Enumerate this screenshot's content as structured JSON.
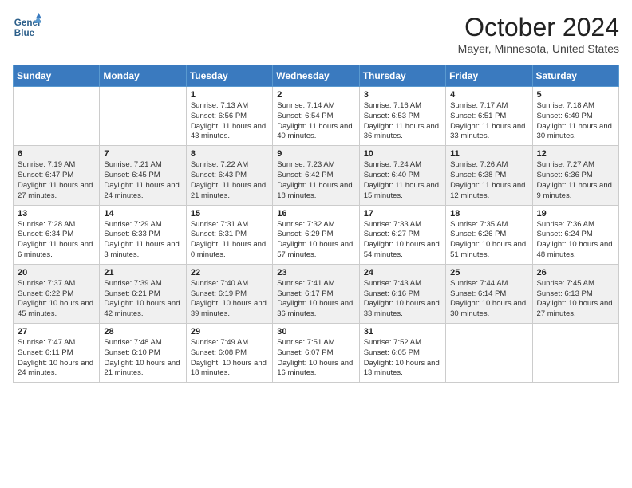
{
  "header": {
    "logo_line1": "General",
    "logo_line2": "Blue",
    "month": "October 2024",
    "location": "Mayer, Minnesota, United States"
  },
  "weekdays": [
    "Sunday",
    "Monday",
    "Tuesday",
    "Wednesday",
    "Thursday",
    "Friday",
    "Saturday"
  ],
  "rows": [
    [
      {
        "day": "",
        "info": ""
      },
      {
        "day": "",
        "info": ""
      },
      {
        "day": "1",
        "info": "Sunrise: 7:13 AM\nSunset: 6:56 PM\nDaylight: 11 hours and 43 minutes."
      },
      {
        "day": "2",
        "info": "Sunrise: 7:14 AM\nSunset: 6:54 PM\nDaylight: 11 hours and 40 minutes."
      },
      {
        "day": "3",
        "info": "Sunrise: 7:16 AM\nSunset: 6:53 PM\nDaylight: 11 hours and 36 minutes."
      },
      {
        "day": "4",
        "info": "Sunrise: 7:17 AM\nSunset: 6:51 PM\nDaylight: 11 hours and 33 minutes."
      },
      {
        "day": "5",
        "info": "Sunrise: 7:18 AM\nSunset: 6:49 PM\nDaylight: 11 hours and 30 minutes."
      }
    ],
    [
      {
        "day": "6",
        "info": "Sunrise: 7:19 AM\nSunset: 6:47 PM\nDaylight: 11 hours and 27 minutes."
      },
      {
        "day": "7",
        "info": "Sunrise: 7:21 AM\nSunset: 6:45 PM\nDaylight: 11 hours and 24 minutes."
      },
      {
        "day": "8",
        "info": "Sunrise: 7:22 AM\nSunset: 6:43 PM\nDaylight: 11 hours and 21 minutes."
      },
      {
        "day": "9",
        "info": "Sunrise: 7:23 AM\nSunset: 6:42 PM\nDaylight: 11 hours and 18 minutes."
      },
      {
        "day": "10",
        "info": "Sunrise: 7:24 AM\nSunset: 6:40 PM\nDaylight: 11 hours and 15 minutes."
      },
      {
        "day": "11",
        "info": "Sunrise: 7:26 AM\nSunset: 6:38 PM\nDaylight: 11 hours and 12 minutes."
      },
      {
        "day": "12",
        "info": "Sunrise: 7:27 AM\nSunset: 6:36 PM\nDaylight: 11 hours and 9 minutes."
      }
    ],
    [
      {
        "day": "13",
        "info": "Sunrise: 7:28 AM\nSunset: 6:34 PM\nDaylight: 11 hours and 6 minutes."
      },
      {
        "day": "14",
        "info": "Sunrise: 7:29 AM\nSunset: 6:33 PM\nDaylight: 11 hours and 3 minutes."
      },
      {
        "day": "15",
        "info": "Sunrise: 7:31 AM\nSunset: 6:31 PM\nDaylight: 11 hours and 0 minutes."
      },
      {
        "day": "16",
        "info": "Sunrise: 7:32 AM\nSunset: 6:29 PM\nDaylight: 10 hours and 57 minutes."
      },
      {
        "day": "17",
        "info": "Sunrise: 7:33 AM\nSunset: 6:27 PM\nDaylight: 10 hours and 54 minutes."
      },
      {
        "day": "18",
        "info": "Sunrise: 7:35 AM\nSunset: 6:26 PM\nDaylight: 10 hours and 51 minutes."
      },
      {
        "day": "19",
        "info": "Sunrise: 7:36 AM\nSunset: 6:24 PM\nDaylight: 10 hours and 48 minutes."
      }
    ],
    [
      {
        "day": "20",
        "info": "Sunrise: 7:37 AM\nSunset: 6:22 PM\nDaylight: 10 hours and 45 minutes."
      },
      {
        "day": "21",
        "info": "Sunrise: 7:39 AM\nSunset: 6:21 PM\nDaylight: 10 hours and 42 minutes."
      },
      {
        "day": "22",
        "info": "Sunrise: 7:40 AM\nSunset: 6:19 PM\nDaylight: 10 hours and 39 minutes."
      },
      {
        "day": "23",
        "info": "Sunrise: 7:41 AM\nSunset: 6:17 PM\nDaylight: 10 hours and 36 minutes."
      },
      {
        "day": "24",
        "info": "Sunrise: 7:43 AM\nSunset: 6:16 PM\nDaylight: 10 hours and 33 minutes."
      },
      {
        "day": "25",
        "info": "Sunrise: 7:44 AM\nSunset: 6:14 PM\nDaylight: 10 hours and 30 minutes."
      },
      {
        "day": "26",
        "info": "Sunrise: 7:45 AM\nSunset: 6:13 PM\nDaylight: 10 hours and 27 minutes."
      }
    ],
    [
      {
        "day": "27",
        "info": "Sunrise: 7:47 AM\nSunset: 6:11 PM\nDaylight: 10 hours and 24 minutes."
      },
      {
        "day": "28",
        "info": "Sunrise: 7:48 AM\nSunset: 6:10 PM\nDaylight: 10 hours and 21 minutes."
      },
      {
        "day": "29",
        "info": "Sunrise: 7:49 AM\nSunset: 6:08 PM\nDaylight: 10 hours and 18 minutes."
      },
      {
        "day": "30",
        "info": "Sunrise: 7:51 AM\nSunset: 6:07 PM\nDaylight: 10 hours and 16 minutes."
      },
      {
        "day": "31",
        "info": "Sunrise: 7:52 AM\nSunset: 6:05 PM\nDaylight: 10 hours and 13 minutes."
      },
      {
        "day": "",
        "info": ""
      },
      {
        "day": "",
        "info": ""
      }
    ]
  ]
}
